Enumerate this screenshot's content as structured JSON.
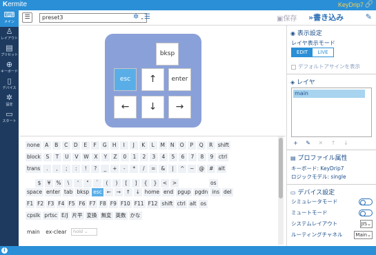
{
  "app": {
    "title_k": "K",
    "title_rest": "ermite",
    "device": "KeyDrip7"
  },
  "sidebar": {
    "items": [
      {
        "label": "メイン",
        "icon": "keyboard-icon",
        "glyph": "⌨",
        "active": true
      },
      {
        "label": "レイアウト",
        "icon": "person-icon",
        "glyph": "♙",
        "active": false
      },
      {
        "label": "プリセット",
        "icon": "folder-icon",
        "glyph": "▤",
        "active": false
      },
      {
        "label": "キーボード",
        "icon": "globe-icon",
        "glyph": "⊕",
        "active": false
      },
      {
        "label": "デバイス",
        "icon": "phone-icon",
        "glyph": "▯",
        "active": false
      },
      {
        "label": "設定",
        "icon": "gear-icon",
        "glyph": "✲",
        "active": false
      },
      {
        "label": "スタート",
        "icon": "document-icon",
        "glyph": "▭",
        "active": false
      }
    ]
  },
  "toolbar": {
    "preset_value": "preset3",
    "save_label": "保存",
    "write_label": "書き込み"
  },
  "preview_keys": {
    "bksp": "bksp",
    "esc": "esc",
    "up": "↑",
    "enter": "enter",
    "left": "←",
    "down": "↓",
    "right": "→"
  },
  "palette": {
    "rows": [
      [
        "none",
        "A",
        "B",
        "C",
        "D",
        "E",
        "F",
        "G",
        "H",
        "I",
        "J",
        "K",
        "L",
        "M",
        "N",
        "O",
        "P",
        "Q",
        "R",
        "shift"
      ],
      [
        "block",
        "S",
        "T",
        "U",
        "V",
        "W",
        "X",
        "Y",
        "Z",
        "0",
        "1",
        "2",
        "3",
        "4",
        "5",
        "6",
        "7",
        "8",
        "9",
        "ctrl"
      ],
      [
        "trans",
        ".",
        ",",
        ";",
        ":",
        "!",
        "?",
        "_",
        "+",
        "-",
        "*",
        "/",
        "=",
        "&",
        "|",
        "^",
        "~",
        "@",
        "#",
        "alt"
      ],
      [
        "",
        "$",
        "¥",
        "%",
        "\\",
        "'",
        "\"",
        "`",
        "(",
        ")",
        "[",
        "]",
        "{",
        "}",
        "<",
        ">",
        "",
        "",
        "",
        "os"
      ],
      [
        "space",
        "enter",
        "tab",
        "bksp",
        "esc",
        "←",
        "→",
        "↑",
        "↓",
        "home",
        "end",
        "pgup",
        "pgdn",
        "ins",
        "del"
      ],
      [
        "F1",
        "F2",
        "F3",
        "F4",
        "F5",
        "F6",
        "F7",
        "F8",
        "F9",
        "F10",
        "F11",
        "F12",
        "shift",
        "ctrl",
        "alt",
        "os"
      ],
      [
        "cpslk",
        "prtsc",
        "E/J",
        "片平",
        "変換",
        "無変",
        "英数",
        "かな"
      ]
    ],
    "layer_row": [
      "main",
      "ex-clear"
    ],
    "hold_placeholder": "hold"
  },
  "right": {
    "display": {
      "title": "表示設定",
      "mode_label": "レイヤ表示モード",
      "edit": "EDIT",
      "live": "LIVE",
      "default_assign": "デフォルトアサインを表示"
    },
    "layers": {
      "title": "レイヤ",
      "items": [
        "main"
      ],
      "tools": [
        "+",
        "✎",
        "✕",
        "↑",
        "↓"
      ]
    },
    "profile": {
      "title": "プロファイル属性",
      "keyboard": "キーボード: KeyDrip7",
      "logic_model": "ロジックモデル: single"
    },
    "device": {
      "title": "デバイス設定",
      "simulator": "シミュレータモード",
      "mute": "ミュートモード",
      "system_layout": "システムレイアウト",
      "system_layout_value": "JIS",
      "routing": "ルーティングチャネル",
      "routing_value": "Main"
    }
  }
}
